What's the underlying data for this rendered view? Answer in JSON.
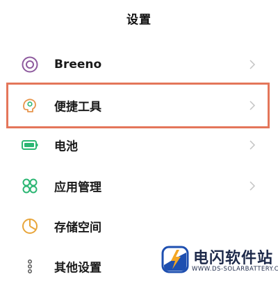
{
  "header": {
    "title": "设置"
  },
  "menu": {
    "items": [
      {
        "label": "Breeno",
        "icon": "breeno-icon"
      },
      {
        "label": "便捷工具",
        "icon": "convenience-tools-icon",
        "highlighted": true
      },
      {
        "label": "电池",
        "icon": "battery-icon"
      },
      {
        "label": "应用管理",
        "icon": "app-management-icon"
      },
      {
        "label": "存储空间",
        "icon": "storage-icon"
      },
      {
        "label": "其他设置",
        "icon": "other-settings-icon"
      }
    ]
  },
  "watermark": {
    "name": "电闪软件站",
    "domain": "WWW.DS-SOLARBATTERY.COM"
  },
  "colors": {
    "accent_green": "#2bb673",
    "highlight_border": "#e4765a",
    "breeno_purple": "#8e5a9e",
    "storage_yellow": "#e8a53a",
    "tools_orange": "#e8944a"
  }
}
